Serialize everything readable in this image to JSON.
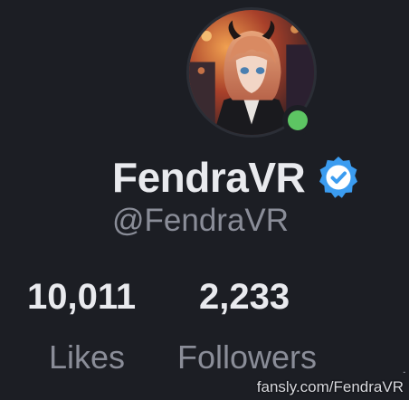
{
  "profile": {
    "display_name": "FendraVR",
    "handle": "@FendraVR",
    "verified": true,
    "online": true
  },
  "stats": [
    {
      "value": "10,011",
      "label": "Likes"
    },
    {
      "value": "2,233",
      "label": "Followers"
    }
  ],
  "watermark": "fansly.com/FendraVR",
  "colors": {
    "background": "#1c1e24",
    "verified_badge": "#3b9cf0",
    "online_indicator": "#5dc563",
    "primary_text": "#e9eaee",
    "secondary_text": "#8a8d98"
  },
  "icons": {
    "verified": "verified-badge-icon",
    "online": "online-status-icon"
  }
}
